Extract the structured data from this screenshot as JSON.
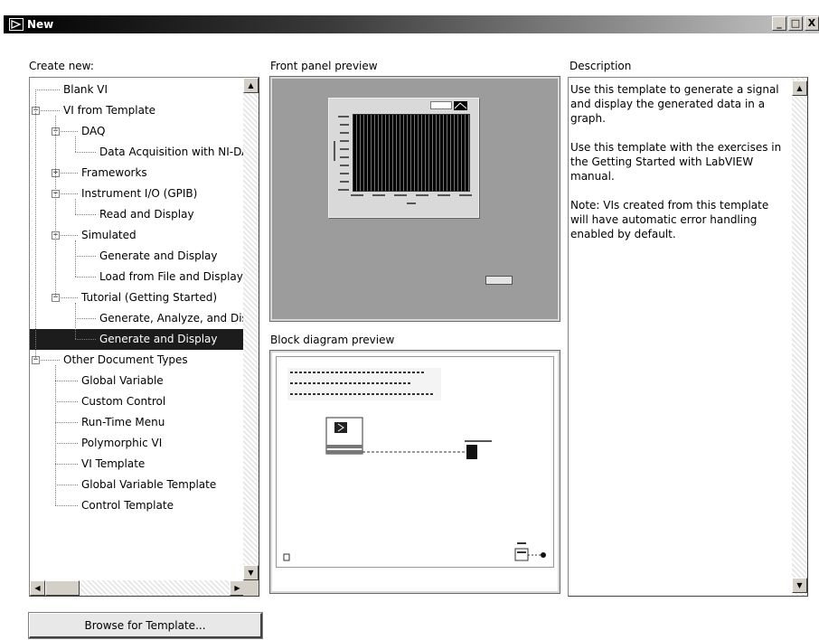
{
  "window": {
    "title": "New",
    "buttons": [
      "_",
      "□",
      "X"
    ]
  },
  "labels": {
    "create_new": "Create new:",
    "front_panel_preview": "Front panel preview",
    "block_diagram_preview": "Block diagram preview",
    "description": "Description"
  },
  "tree": {
    "items": [
      {
        "label": "Blank VI",
        "level": 0,
        "expander": "",
        "selected": false
      },
      {
        "label": "VI from Template",
        "level": 0,
        "expander": "-",
        "selected": false
      },
      {
        "label": "DAQ",
        "level": 1,
        "expander": "-",
        "selected": false
      },
      {
        "label": "Data Acquisition with NI-DAQ",
        "level": 2,
        "expander": "",
        "selected": false
      },
      {
        "label": "Frameworks",
        "level": 1,
        "expander": "+",
        "selected": false
      },
      {
        "label": "Instrument I/O (GPIB)",
        "level": 1,
        "expander": "-",
        "selected": false
      },
      {
        "label": "Read and Display",
        "level": 2,
        "expander": "",
        "selected": false
      },
      {
        "label": "Simulated",
        "level": 1,
        "expander": "-",
        "selected": false
      },
      {
        "label": "Generate and Display",
        "level": 2,
        "expander": "",
        "selected": false
      },
      {
        "label": "Load from File and Display",
        "level": 2,
        "expander": "",
        "selected": false
      },
      {
        "label": "Tutorial (Getting Started)",
        "level": 1,
        "expander": "-",
        "selected": false
      },
      {
        "label": "Generate, Analyze, and Disp",
        "level": 2,
        "expander": "",
        "selected": false
      },
      {
        "label": "Generate and Display",
        "level": 2,
        "expander": "",
        "selected": true
      },
      {
        "label": "Other Document Types",
        "level": 0,
        "expander": "-",
        "selected": false
      },
      {
        "label": "Global Variable",
        "level": 1,
        "expander": "",
        "selected": false
      },
      {
        "label": "Custom Control",
        "level": 1,
        "expander": "",
        "selected": false
      },
      {
        "label": "Run-Time Menu",
        "level": 1,
        "expander": "",
        "selected": false
      },
      {
        "label": "Polymorphic VI",
        "level": 1,
        "expander": "",
        "selected": false
      },
      {
        "label": "VI Template",
        "level": 1,
        "expander": "",
        "selected": false
      },
      {
        "label": "Global Variable Template",
        "level": 1,
        "expander": "",
        "selected": false
      },
      {
        "label": "Control Template",
        "level": 1,
        "expander": "",
        "selected": false
      }
    ]
  },
  "description": {
    "text": "Use this template to generate a signal and display the generated data in a graph.\n\nUse this template with the exercises in the Getting Started with LabVIEW manual.\n\nNote: VIs created from this template will have automatic error handling enabled by default."
  },
  "browse_button": "Browse for Template...",
  "colors": {
    "selection": "#1c1c1c",
    "front_panel_bg": "#9c9c9c"
  }
}
